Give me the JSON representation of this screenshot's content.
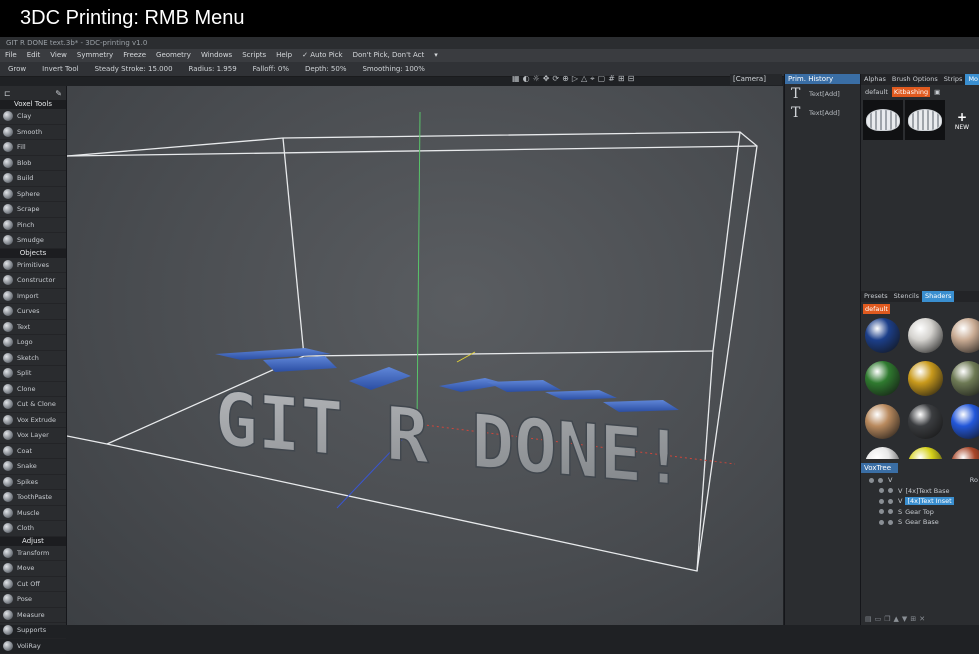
{
  "video_title": "3DC Printing: RMB Menu",
  "app_title": "GIT R DONE text.3b* - 3DC-printing v1.0",
  "menu": [
    "File",
    "Edit",
    "View",
    "Symmetry",
    "Freeze",
    "Geometry",
    "Windows",
    "Scripts",
    "Help",
    "✓ Auto Pick",
    "Don't Pick, Don't Act",
    "▾"
  ],
  "toolbar": {
    "grow": "Grow",
    "invert": "Invert Tool",
    "steady": "Steady Stroke: 15.000",
    "radius": "Radius: 1.959",
    "falloff": "Falloff: 0%",
    "depth": "Depth: 50%",
    "smoothing": "Smoothing: 100%"
  },
  "camera_select": "[Camera]",
  "sections": {
    "voxel_tools": {
      "label": "Voxel Tools",
      "items": [
        "Clay",
        "Smooth",
        "Fill",
        "Blob",
        "Build",
        "Sphere",
        "Scrape",
        "Pinch",
        "Smudge"
      ]
    },
    "objects": {
      "label": "Objects",
      "items": [
        "Primitives",
        "Constructor",
        "Import",
        "Curves",
        "Text",
        "Logo",
        "Sketch",
        "Split",
        "Clone",
        "Cut & Clone",
        "Vox Extrude",
        "Vox Layer",
        "Coat",
        "Snake",
        "Spikes",
        "ToothPaste",
        "Muscle",
        "Cloth"
      ]
    },
    "adjust": {
      "label": "Adjust",
      "items": [
        "Transform",
        "Move",
        "Cut Off",
        "Pose",
        "Measure",
        "Supports",
        "VoliRay"
      ]
    }
  },
  "viewport": {
    "text": "GIT R DONE!"
  },
  "history": {
    "tab": "Prim. History",
    "items": [
      "Text[Add]",
      "Text[Add]"
    ]
  },
  "top_tabs": [
    "Alphas",
    "Brush Options",
    "Strips",
    "Mo"
  ],
  "kitbash": {
    "default_label": "default",
    "active_label": "Kitbashing",
    "new_label": "NEW"
  },
  "shader_tabs": [
    "Presets",
    "Stencils",
    "Shaders"
  ],
  "shader_default": "default",
  "shader_colors": [
    "#1c3f8a",
    "#d5d3cf",
    "#c9ab93",
    "#2f7a2f",
    "#c99a1c",
    "#6e7a55",
    "#b98a5e",
    "#3b3d40",
    "#2357d9",
    "#e8e8e8",
    "#d6d21a",
    "#a9472a"
  ],
  "voxtree": {
    "tab": "VoxTree",
    "rows": [
      {
        "indent": 0,
        "type": "V",
        "name": "",
        "right": "Ro"
      },
      {
        "indent": 1,
        "type": "V",
        "name": "[4x]Text Base"
      },
      {
        "indent": 1,
        "type": "V",
        "name": "[4x]Text Inset",
        "selected": true
      },
      {
        "indent": 1,
        "type": "S",
        "name": "Gear Top"
      },
      {
        "indent": 1,
        "type": "S",
        "name": "Gear Base"
      }
    ]
  }
}
